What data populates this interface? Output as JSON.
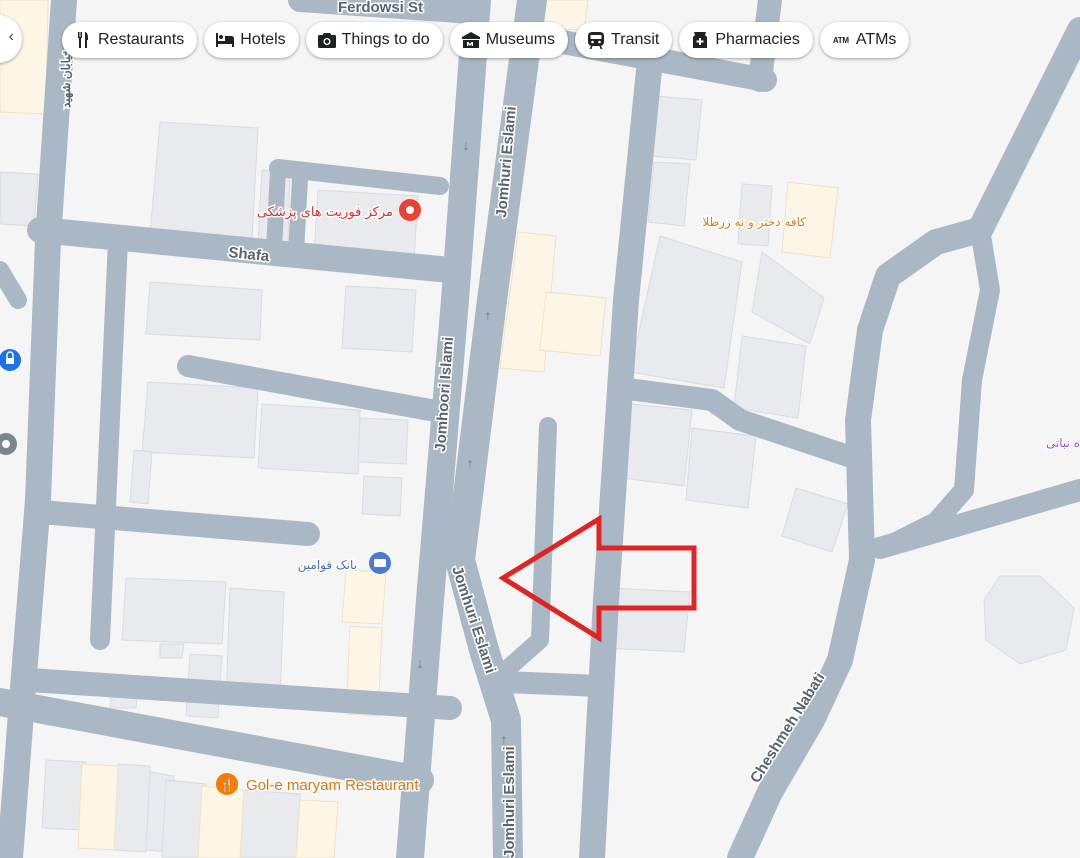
{
  "categories": [
    {
      "id": "restaurants",
      "label": "Restaurants",
      "icon": "fork-knife-icon"
    },
    {
      "id": "hotels",
      "label": "Hotels",
      "icon": "bed-icon"
    },
    {
      "id": "things",
      "label": "Things to do",
      "icon": "camera-icon"
    },
    {
      "id": "museums",
      "label": "Museums",
      "icon": "museum-icon"
    },
    {
      "id": "transit",
      "label": "Transit",
      "icon": "train-icon"
    },
    {
      "id": "pharmacies",
      "label": "Pharmacies",
      "icon": "pharmacy-icon"
    },
    {
      "id": "atms",
      "label": "ATMs",
      "icon": "atm-icon"
    }
  ],
  "streets": {
    "ferdowsi": "Ferdowsi St",
    "shafa": "Shafa",
    "jomhoori_islami": "Jomhoori Islami",
    "jomhuri_eslami_top": "Jomhuri Eslami",
    "jomhuri_eslami_mid": "Jomhuri Eslami",
    "jomhuri_eslami_bottom": "Jomhuri Eslami",
    "cheshmeh_nabati": "Cheshmeh Nabati",
    "left_vertical": "خیابان شهید"
  },
  "places": {
    "medical_center": "مرکز فوریت های پزشکی",
    "bank": "بانک قوامین",
    "cafe": "کافه دختر و نه زرطلا",
    "gol_e_maryam": "Gol-e maryam Restaurant",
    "right_edge": "ه نباتی"
  },
  "colors": {
    "road": "#aab8c6",
    "background": "#f5f5f5",
    "building": "#e8eaed",
    "commercial": "#fdf6e6",
    "poi_red": "#ea4335",
    "poi_orange": "#f57c00",
    "poi_blue": "#4a7bd1",
    "arrow": "#e02424"
  }
}
